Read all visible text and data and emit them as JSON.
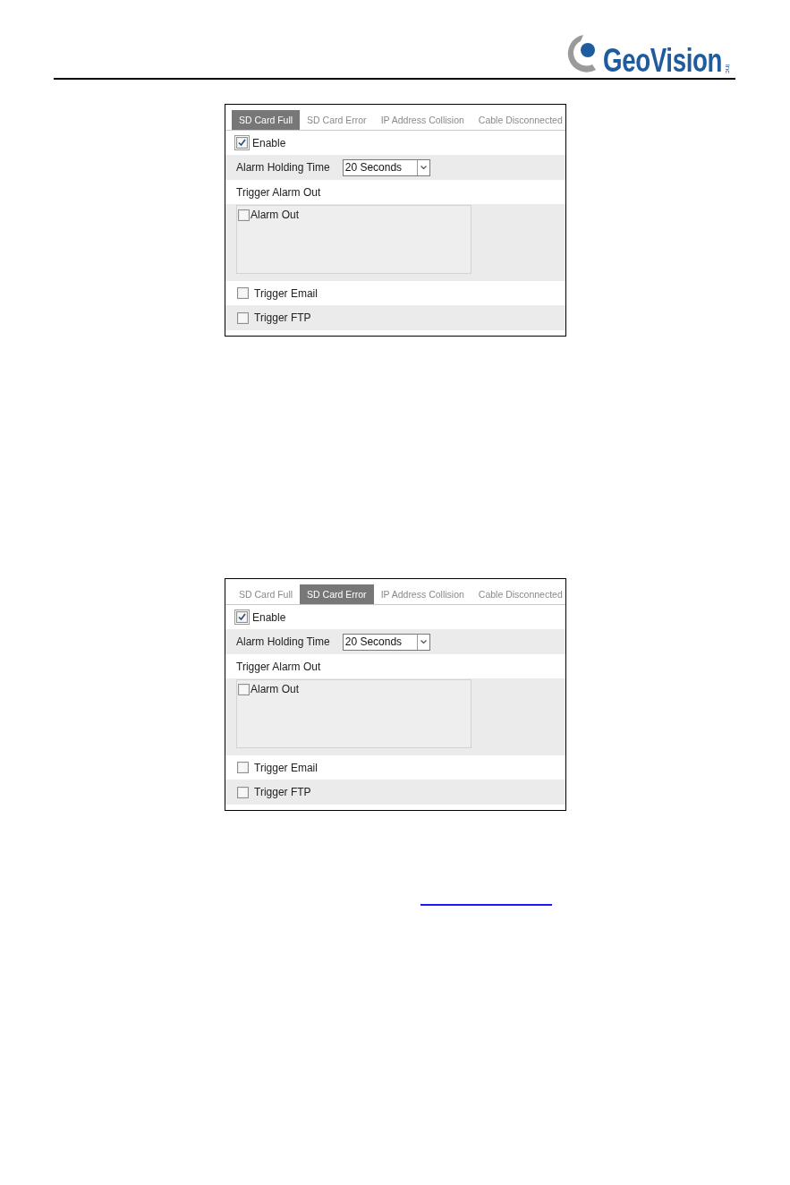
{
  "header": {
    "logo_text": "GeoVision",
    "logo_suffix": "inc"
  },
  "panels": [
    {
      "tabs": [
        {
          "label": "SD Card Full",
          "selected": true
        },
        {
          "label": "SD Card Error",
          "selected": false
        },
        {
          "label": "IP Address Collision",
          "selected": false
        },
        {
          "label": "Cable Disconnected",
          "selected": false
        }
      ],
      "enable": {
        "label": "Enable",
        "checked": true,
        "focused": true
      },
      "holding_time": {
        "label": "Alarm Holding Time",
        "value": "20 Seconds"
      },
      "alarm_out": {
        "label": "Trigger Alarm Out",
        "items": [
          {
            "label": "Alarm Out",
            "checked": false
          }
        ]
      },
      "triggers": [
        {
          "label": "Trigger Email",
          "checked": false
        },
        {
          "label": "Trigger FTP",
          "checked": false
        }
      ]
    },
    {
      "tabs": [
        {
          "label": "SD Card Full",
          "selected": false
        },
        {
          "label": "SD Card Error",
          "selected": true
        },
        {
          "label": "IP Address Collision",
          "selected": false
        },
        {
          "label": "Cable Disconnected",
          "selected": false
        }
      ],
      "enable": {
        "label": "Enable",
        "checked": true,
        "focused": true
      },
      "holding_time": {
        "label": "Alarm Holding Time",
        "value": "20 Seconds"
      },
      "alarm_out": {
        "label": "Trigger Alarm Out",
        "items": [
          {
            "label": "Alarm Out",
            "checked": false
          }
        ]
      },
      "triggers": [
        {
          "label": "Trigger Email",
          "checked": false
        },
        {
          "label": "Trigger FTP",
          "checked": false
        }
      ]
    }
  ]
}
